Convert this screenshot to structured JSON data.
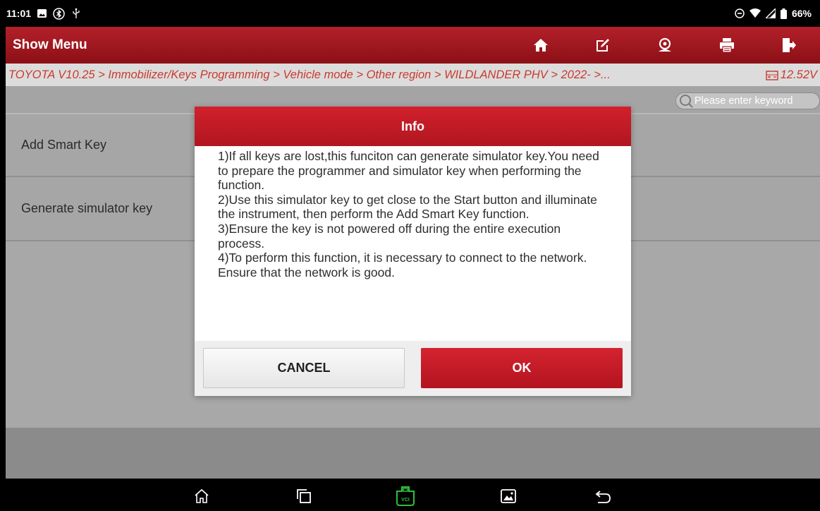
{
  "status_bar": {
    "time": "11:01",
    "battery": "66%",
    "icons": [
      "image-icon",
      "bluetooth-icon",
      "usb-icon",
      "dnd-icon",
      "wifi-icon",
      "signal-icon",
      "battery-icon"
    ]
  },
  "header": {
    "menu_label": "Show Menu",
    "buttons": [
      "home-icon",
      "edit-icon",
      "support-icon",
      "print-icon",
      "exit-icon"
    ]
  },
  "breadcrumb": {
    "path": "TOYOTA V10.25 > Immobilizer/Keys Programming > Vehicle mode > Other region > WILDLANDER PHV > 2022- >...",
    "voltage": "12.52V"
  },
  "search": {
    "placeholder": "Please enter keyword"
  },
  "list": {
    "items": [
      {
        "label": "Add Smart Key"
      },
      {
        "label": "Generate simulator key"
      }
    ]
  },
  "dialog": {
    "title": "Info",
    "lines": [
      "1)If all keys are lost,this funciton can generate simulator key.You need to prepare the programmer and simulator key when performing the function.",
      "2)Use this simulator key to get close to the Start button and illuminate the instrument, then perform the Add Smart Key function.",
      "3)Ensure the key is not powered off during the entire execution process.",
      "4)To perform this function, it is necessary to connect to the network. Ensure that the network is good."
    ],
    "cancel_label": "CANCEL",
    "ok_label": "OK"
  },
  "nav": {
    "buttons": [
      "nav-home-icon",
      "recents-icon",
      "vci-icon",
      "screenshot-icon",
      "back-icon"
    ],
    "vci_label": "VCI"
  },
  "colors": {
    "accent": "#b11620",
    "breadcrumb_text": "#c93a2e",
    "vci_green": "#2fbf3a"
  }
}
